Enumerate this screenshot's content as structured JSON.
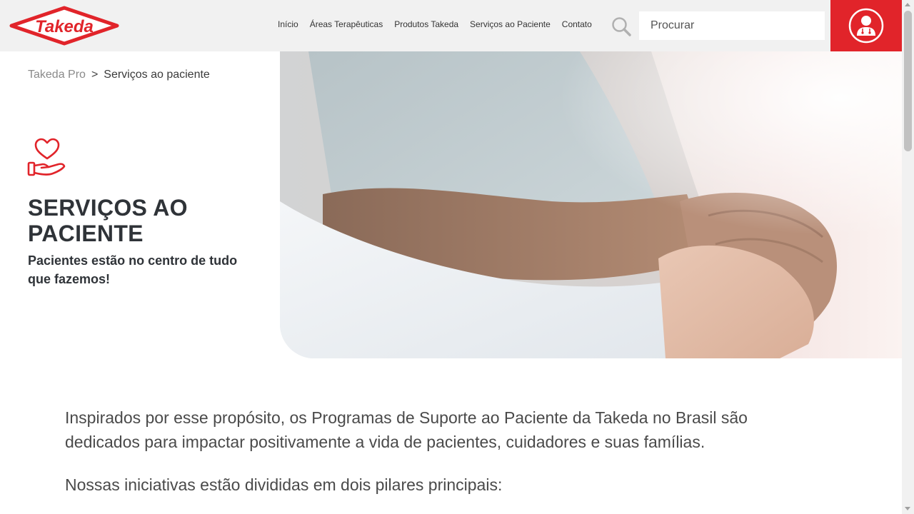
{
  "brand": {
    "logo_text": "Takeda",
    "accent_color": "#e1242a"
  },
  "nav": {
    "items": [
      {
        "label": "Início"
      },
      {
        "label": "Áreas Terapêuticas"
      },
      {
        "label": "Produtos Takeda"
      },
      {
        "label": "Serviços ao Paciente"
      },
      {
        "label": "Contato"
      }
    ]
  },
  "search": {
    "placeholder": "Procurar",
    "icon": "search-icon"
  },
  "hcp_button": {
    "icon": "doctor-icon"
  },
  "breadcrumb": {
    "home": "Takeda Pro",
    "separator": ">",
    "current": "Serviços ao paciente"
  },
  "hero": {
    "icon": "heart-hand-icon",
    "title": "SERVIÇOS AO PACIENTE",
    "subtitle": "Pacientes estão no centro de tudo que fazemos!",
    "image": "holding-hands-photo"
  },
  "content": {
    "intro": "Inspirados por esse propósito, os Programas de Suporte ao Paciente da Takeda no Brasil são dedicados para impactar positivamente a vida de pacientes, cuidadores e suas famílias.",
    "pillars_intro": "Nossas iniciativas estão divididas em dois pilares principais:"
  }
}
